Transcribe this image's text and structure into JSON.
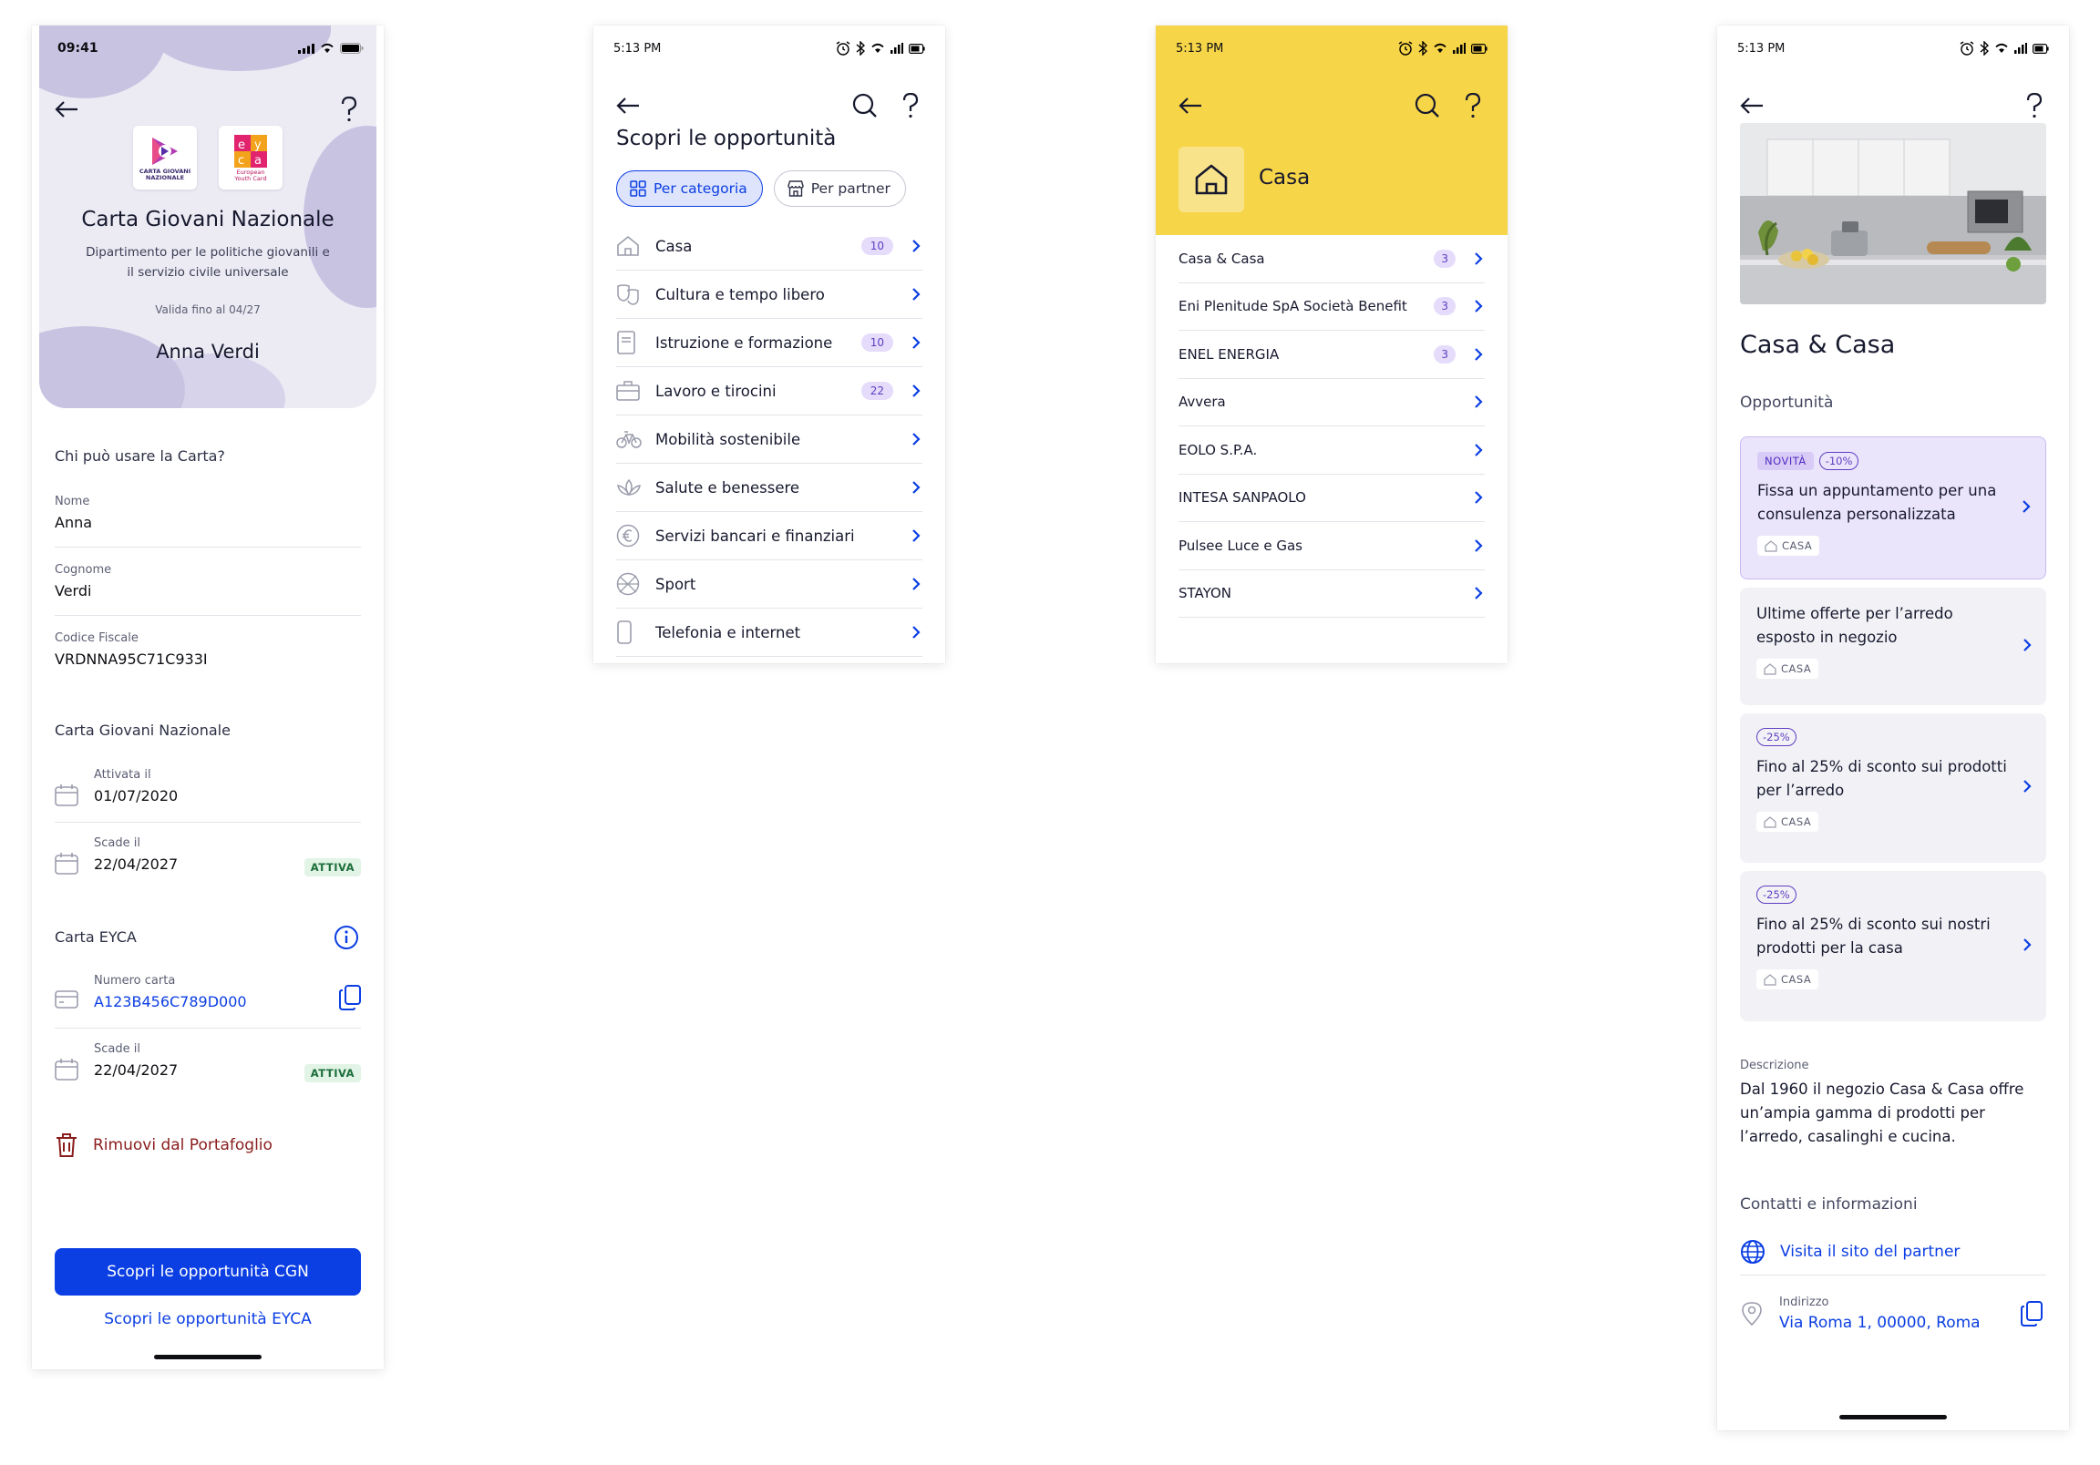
{
  "screen1": {
    "status_time": "09:41",
    "card_title": "Carta Giovani Nazionale",
    "card_subtitle": "Dipartimento per le politiche giovanili e il servizio civile universale",
    "valid_until": "Valida fino al 04/27",
    "holder_name": "Anna Verdi",
    "logo_cgn_text": "CARTA GIOVANI NAZIONALE",
    "logo_eyca_text": "European Youth Card",
    "who_title": "Chi può usare la Carta?",
    "fields": [
      {
        "label": "Nome",
        "value": "Anna"
      },
      {
        "label": "Cognome",
        "value": "Verdi"
      },
      {
        "label": "Codice Fiscale",
        "value": "VRDNNA95C71C933I"
      }
    ],
    "cgn_section_title": "Carta Giovani Nazionale",
    "cgn_rows": [
      {
        "label": "Attivata il",
        "value": "01/07/2020",
        "badge": ""
      },
      {
        "label": "Scade il",
        "value": "22/04/2027",
        "badge": "ATTIVA"
      }
    ],
    "eyca_section_title": "Carta EYCA",
    "eyca_number_label": "Numero carta",
    "eyca_number_value": "A123B456C789D000",
    "eyca_expiry_label": "Scade il",
    "eyca_expiry_value": "22/04/2027",
    "eyca_badge": "ATTIVA",
    "remove_label": "Rimuovi dal Portafoglio",
    "primary_button": "Scopri le opportunità CGN",
    "link_button": "Scopri le opportunità EYCA",
    "accent_color": "#0b3ee3"
  },
  "screen2": {
    "status_time": "5:13 PM",
    "title": "Scopri le opportunità",
    "tabs": [
      {
        "label": "Per categoria",
        "active": true
      },
      {
        "label": "Per partner",
        "active": false
      }
    ],
    "categories": [
      {
        "label": "Casa",
        "count": "10",
        "icon": "home-icon"
      },
      {
        "label": "Cultura e tempo libero",
        "count": "",
        "icon": "theater-masks-icon"
      },
      {
        "label": "Istruzione e formazione",
        "count": "10",
        "icon": "book-icon"
      },
      {
        "label": "Lavoro e tirocini",
        "count": "22",
        "icon": "briefcase-icon"
      },
      {
        "label": "Mobilità sostenibile",
        "count": "",
        "icon": "bicycle-icon"
      },
      {
        "label": "Salute e benessere",
        "count": "",
        "icon": "lotus-icon"
      },
      {
        "label": "Servizi bancari e finanziari",
        "count": "",
        "icon": "euro-icon"
      },
      {
        "label": "Sport",
        "count": "",
        "icon": "ball-icon"
      },
      {
        "label": "Telefonia e internet",
        "count": "",
        "icon": "phone-icon"
      }
    ]
  },
  "screen3": {
    "status_time": "5:13 PM",
    "category_name": "Casa",
    "header_color": "#f7d549",
    "partners": [
      {
        "label": "Casa & Casa",
        "count": "3"
      },
      {
        "label": "Eni Plenitude SpA Società Benefit",
        "count": "3"
      },
      {
        "label": "ENEL ENERGIA",
        "count": "3"
      },
      {
        "label": "Avvera",
        "count": ""
      },
      {
        "label": "EOLO S.P.A.",
        "count": ""
      },
      {
        "label": "INTESA SANPAOLO",
        "count": ""
      },
      {
        "label": "Pulsee Luce e Gas",
        "count": ""
      },
      {
        "label": "STAYON",
        "count": ""
      }
    ]
  },
  "screen4": {
    "status_time": "5:13 PM",
    "partner_name": "Casa & Casa",
    "opportunities_title": "Opportunità",
    "offers": [
      {
        "tag_new": "NOVITÀ",
        "tag_pct": "-10%",
        "title": "Fissa un appuntamento per una consulenza personalizzata",
        "category": "CASA"
      },
      {
        "tag_new": "",
        "tag_pct": "",
        "title": "Ultime offerte per l’arredo esposto in negozio",
        "category": "CASA"
      },
      {
        "tag_new": "",
        "tag_pct": "-25%",
        "title": "Fino al 25% di sconto sui prodotti per l’arredo",
        "category": "CASA"
      },
      {
        "tag_new": "",
        "tag_pct": "-25%",
        "title": "Fino al 25% di sconto sui nostri prodotti per la casa",
        "category": "CASA"
      }
    ],
    "description_label": "Descrizione",
    "description_text": "Dal 1960 il negozio Casa & Casa offre un’ampia gamma di prodotti per l’arredo, casalinghi e cucina.",
    "contacts_title": "Contatti e informazioni",
    "website_link": "Visita il sito del partner",
    "address_label": "Indirizzo",
    "address_value": "Via Roma 1, 00000, Roma"
  }
}
